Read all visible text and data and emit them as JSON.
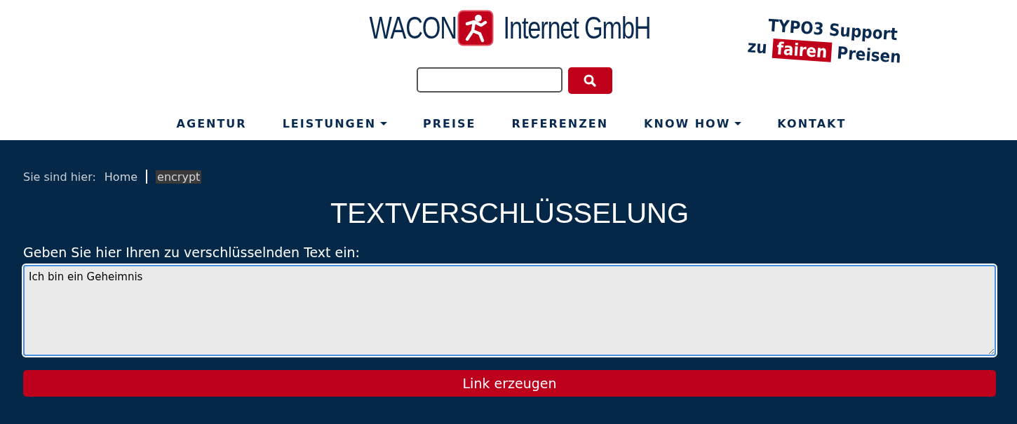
{
  "logo": {
    "left": "WACON",
    "right": "Internet GmbH"
  },
  "slogan": {
    "line_1": "TYPO3 Support",
    "before": "zu",
    "highlight": "fairen",
    "after": "Preisen"
  },
  "nav": [
    {
      "label": "AGENTUR",
      "dropdown": false
    },
    {
      "label": "LEISTUNGEN",
      "dropdown": true
    },
    {
      "label": "PREISE",
      "dropdown": false
    },
    {
      "label": "REFERENZEN",
      "dropdown": false
    },
    {
      "label": "KNOW HOW",
      "dropdown": true
    },
    {
      "label": "KONTAKT",
      "dropdown": false
    }
  ],
  "breadcrumb": {
    "prefix": "Sie sind hier:",
    "items": [
      {
        "label": "Home",
        "selected": false
      },
      {
        "label": "encrypt",
        "selected": true
      }
    ]
  },
  "heading": "TEXTVERSCHLÜSSELUNG",
  "form": {
    "label": "Geben Sie hier Ihren zu verschlüsselnden Text ein:",
    "value": "Ich bin ein Geheimnis",
    "focused": true,
    "button": "Link erzeugen"
  }
}
